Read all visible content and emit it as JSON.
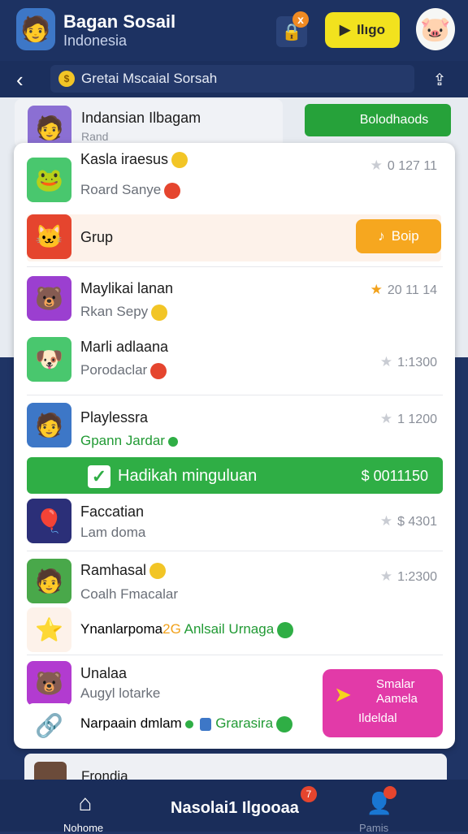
{
  "header": {
    "title": "Bagan Sosail",
    "subtitle": "Indonesia",
    "play_label": "Ilıgo",
    "lock_badge": "x"
  },
  "subbar": {
    "back": "‹",
    "breadcrumb": "Gretai Mscaial Sorsah",
    "coin": "$",
    "share": "⇪"
  },
  "group_card": {
    "title": "Indansian Ilbagam",
    "sub": "Rand",
    "button_label": "Bolodhaods"
  },
  "rows": [
    {
      "title": "Kasla iraesus",
      "sub": "Roard Sanye",
      "value": "0 127 11"
    },
    {
      "title": "Grup",
      "button_label": "Boip"
    },
    {
      "title": "Maylikai lanan",
      "sub": "Rkan Sepy",
      "value": "20 11 14"
    },
    {
      "title": "Marli adlaana",
      "sub": "Porodaclar",
      "value": "1:1300"
    },
    {
      "title": "Playlessra",
      "sub": "Gpann Jardar",
      "value": "1 1200"
    }
  ],
  "banner": {
    "label": "Hadikah minguluan",
    "value": "$ 0011150"
  },
  "rows2": [
    {
      "title": "Faccatian",
      "sub": "Lam doma",
      "value": "$ 4301"
    },
    {
      "title": "Ramhasal",
      "sub": "Coalh Fmacalar",
      "value": "1:2300"
    }
  ],
  "mixed_line": {
    "part1": "Ynanlarpoma",
    "part2": "2G",
    "part3": "Anlsail Urnaga"
  },
  "row_last": {
    "title": "Unalaa",
    "sub": "Augyl lotarke"
  },
  "mixed_line2": {
    "part1": "Narpaain dmlam",
    "part2": "Grarasira"
  },
  "magenta_card": {
    "line1": "Smalar",
    "line2": "Aamela",
    "line3": "Ildeldal"
  },
  "peek": {
    "title": "Frondia"
  },
  "tabbar": {
    "home_label": "Nohome",
    "center_label": "Nasolai1 Ilgooaa",
    "center_badge": "7",
    "profile_label": "Pamis"
  },
  "colors": {
    "header_bg": "#1d3262",
    "accent_green": "#2fae45",
    "accent_orange": "#f6a71f",
    "accent_yellow": "#f2e21e",
    "accent_magenta": "#e23aa8"
  }
}
